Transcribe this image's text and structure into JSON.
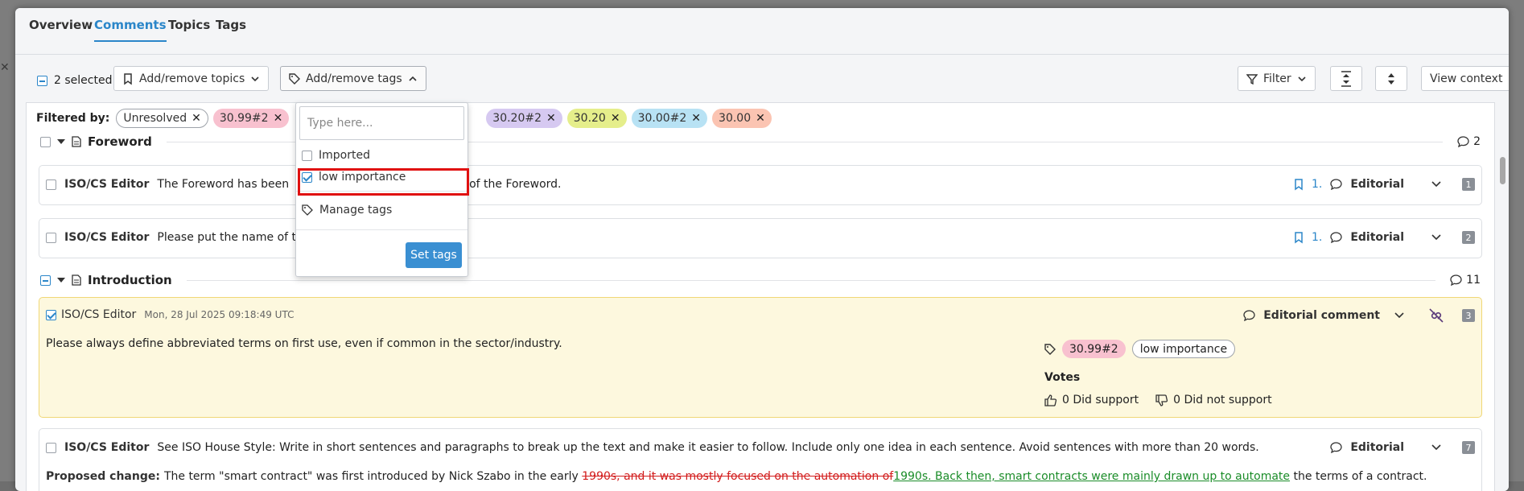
{
  "tabs": [
    "Overview",
    "Comments",
    "Topics",
    "Tags"
  ],
  "toolbar": {
    "selected": "2 selected",
    "add_topics": "Add/remove topics",
    "add_tags": "Add/remove tags",
    "filter": "Filter",
    "view_context": "View context"
  },
  "filters": {
    "label": "Filtered by:",
    "chips": [
      {
        "text": "Unresolved",
        "color": "#ffffff"
      },
      {
        "text": "30.99#2",
        "color": "#f8c1cf"
      },
      {
        "text": "30.20#2",
        "color": "#d6c9f1"
      },
      {
        "text": "30.20",
        "color": "#e5ee8b"
      },
      {
        "text": "30.00#2",
        "color": "#b8e2f4"
      },
      {
        "text": "30.00",
        "color": "#fbc4b2"
      }
    ]
  },
  "dropdown": {
    "placeholder": "Type here...",
    "items": [
      "Imported",
      "low importance"
    ],
    "manage": "Manage tags",
    "set": "Set tags"
  },
  "sections": {
    "foreword": {
      "title": "Foreword",
      "count": "2"
    },
    "introduction": {
      "title": "Introduction",
      "count": "11"
    }
  },
  "comments": [
    {
      "author": "ISO/CS Editor",
      "text_a": "The Foreword has been",
      "text_b": "sion of the Foreword.",
      "topic_num": "1.",
      "type": "Editorial",
      "num": "1"
    },
    {
      "author": "ISO/CS Editor",
      "text_a": "Please put the name of t",
      "topic_num": "1.",
      "type": "Editorial",
      "num": "2"
    },
    {
      "author": "ISO/CS Editor",
      "date": "Mon, 28 Jul 2025 09:18:49 UTC",
      "text": "Please always define abbreviated terms on first use, even if common in the sector/industry.",
      "type": "Editorial comment",
      "num": "3",
      "tags": [
        "30.99#2",
        "low importance"
      ],
      "votes_label": "Votes",
      "support": "0 Did support",
      "not_support": "0 Did not support"
    },
    {
      "author": "ISO/CS Editor",
      "text": "See ISO House Style: Write in short sentences and paragraphs to break up the text and make it easier to follow. Include only one idea in each sentence. Avoid sentences with more than 20 words.",
      "type": "Editorial",
      "num": "7",
      "proposed_label": "Proposed change:",
      "pc_prefix": "The term \"smart contract\" was first introduced by Nick Szabo in the early ",
      "pc_deleted": "1990s, and it was mostly focused on the automation of ",
      "pc_inserted": "1990s. Back then, smart contracts were mainly drawn up to automate",
      "pc_suffix": " the terms of a contract."
    }
  ]
}
